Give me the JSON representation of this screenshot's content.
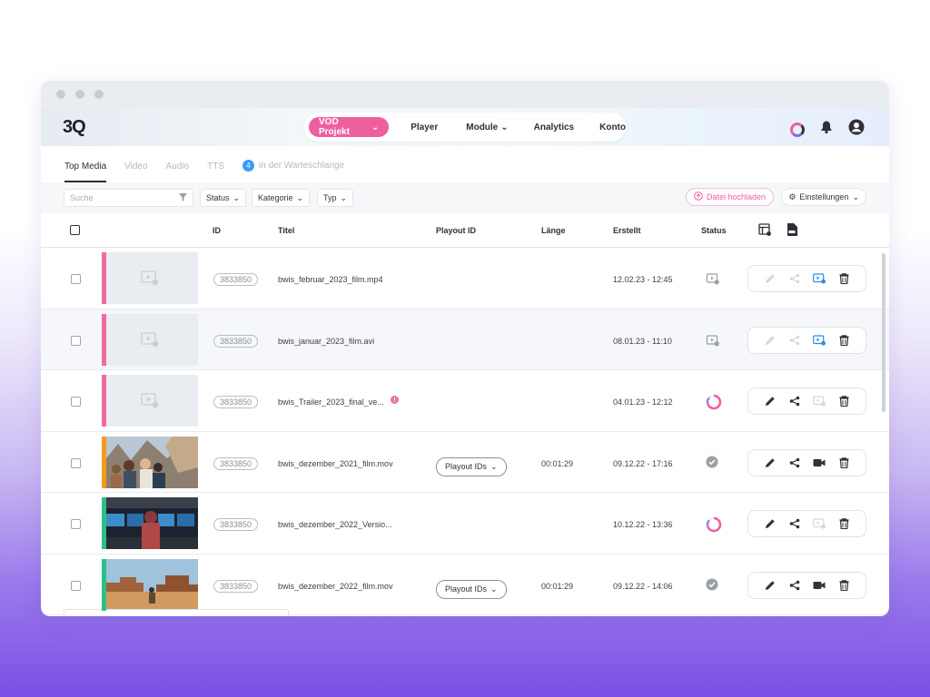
{
  "app": {
    "logo": "3Q"
  },
  "nav": {
    "project": "VOD Projekt",
    "items": [
      "Player",
      "Module",
      "Analytics",
      "Konto"
    ]
  },
  "tabs": {
    "items": [
      "Top Media",
      "Video",
      "Audio",
      "TTS"
    ],
    "queue_count": "4",
    "queue_label": "in der Warteschlange"
  },
  "toolbar": {
    "search_placeholder": "Suche",
    "filters": [
      "Status",
      "Kategorie",
      "Typ"
    ],
    "upload_label": "Datei hochladen",
    "settings_label": "Einstellungen"
  },
  "table": {
    "headers": {
      "id": "ID",
      "title": "Titel",
      "playout": "Playout ID",
      "length": "Länge",
      "created": "Erstellt",
      "status": "Status"
    },
    "rows": [
      {
        "id": "3833850",
        "title": "bwis_februar_2023_film.mp4",
        "length": "",
        "created": "12.02.23 - 12:45",
        "playout": "",
        "status": "processing-icon",
        "bar": "#ef6aa0",
        "thumb": "placeholder"
      },
      {
        "id": "3833850",
        "title": "bwis_januar_2023_film.avi",
        "length": "",
        "created": "08.01.23 - 11:10",
        "playout": "",
        "status": "processing-icon",
        "bar": "#ef6aa0",
        "thumb": "placeholder"
      },
      {
        "id": "3833850",
        "title": "bwis_Trailer_2023_final_ve...",
        "length": "",
        "created": "04.01.23 - 12:12",
        "playout": "",
        "status": "loading-ring-icon",
        "bar": "#ef6aa0",
        "thumb": "placeholder"
      },
      {
        "id": "3833850",
        "title": "bwis_dezember_2021_film.mov",
        "length": "00:01:29",
        "created": "09.12.22 - 17:16",
        "playout": "Playout IDs",
        "status": "check-icon",
        "bar": "#f39a1e",
        "thumb": "group-photo"
      },
      {
        "id": "3833850",
        "title": "bwis_dezember_2022_Versio...",
        "length": "",
        "created": "10.12.22 - 13:36",
        "playout": "",
        "status": "loading-ring-icon",
        "bar": "#2fbf87",
        "thumb": "control-room"
      },
      {
        "id": "3833850",
        "title": "bwis_dezember_2022_film.mov",
        "length": "00:01:29",
        "created": "09.12.22 - 14:06",
        "playout": "Playout IDs",
        "status": "check-icon",
        "bar": "#2fbf87",
        "thumb": "desert"
      }
    ]
  },
  "colors": {
    "accent": "#ee5fa0",
    "blue": "#3b9cff"
  }
}
